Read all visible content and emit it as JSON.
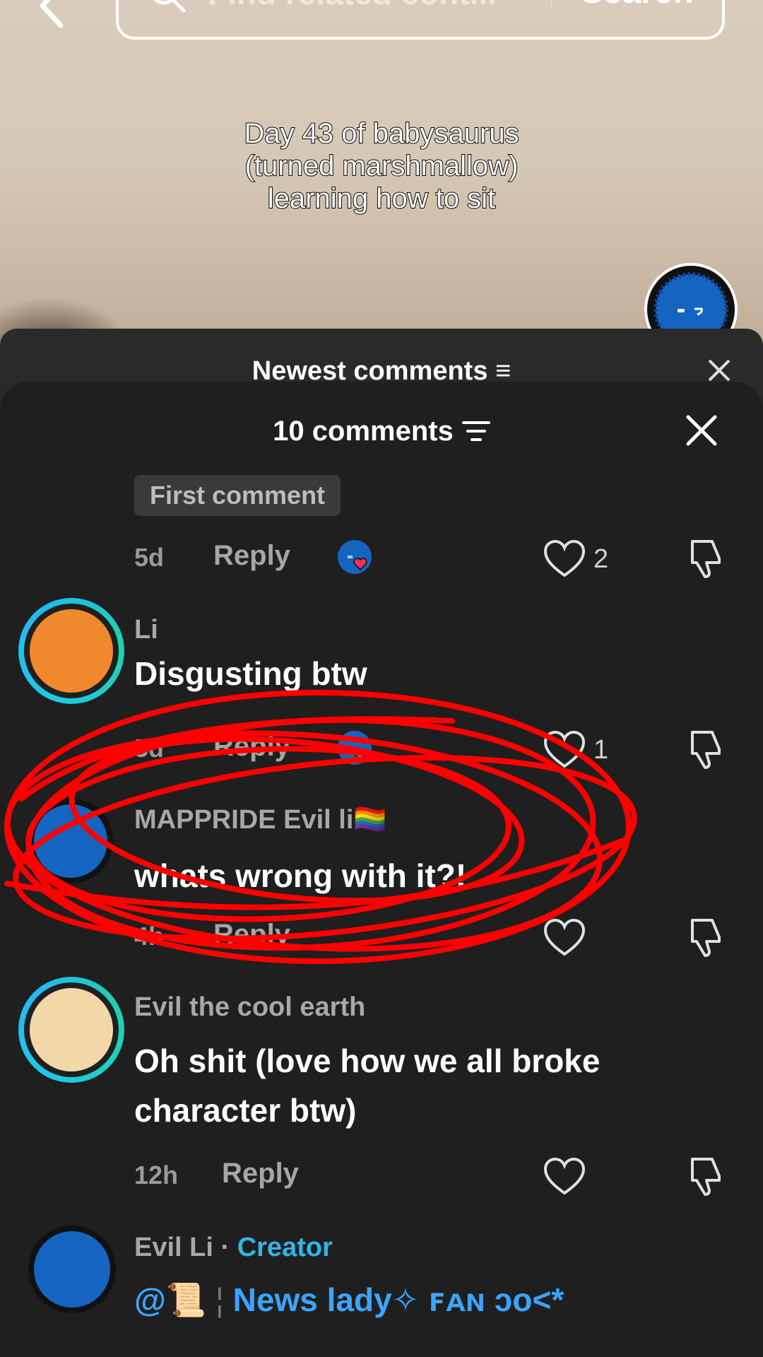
{
  "header": {
    "search_placeholder": "Find related cont...",
    "search_button": "Search"
  },
  "video": {
    "caption_lines": [
      "Day 43 of babysaurus",
      "(turned marshmallow)",
      "learning how to sit"
    ]
  },
  "ghost_sheet": {
    "title": "Newest comments"
  },
  "sheet": {
    "title": "10 comments",
    "first_comment_badge": "First comment",
    "first_comment_actions": {
      "time": "5d",
      "reply": "Reply",
      "likes": "2"
    }
  },
  "comments": [
    {
      "name": "Li",
      "text": "Disgusting btw",
      "time": "5d",
      "reply": "Reply",
      "likes": "1",
      "avatar_color": "#f0892e"
    },
    {
      "name": "MAPPRIDE Evil li🏳️‍🌈",
      "text": "whats wrong with it?!",
      "time": "4h",
      "reply": "Reply",
      "likes": "",
      "avatar_color": "#1565c0"
    },
    {
      "name": "Evil the cool earth",
      "text": "Oh shit (love how we all broke character btw)",
      "time": "12h",
      "reply": "Reply",
      "likes": "",
      "avatar_color": "#f2d7a8"
    },
    {
      "name": "Evil Li",
      "creator_sep": "·",
      "creator_label": "Creator",
      "text_prefix": "@📜",
      "text_mention": "News lady✧ ꜰᴀɴ ↄᴏ<*",
      "avatar_color": "#1565c0"
    }
  ],
  "colors": {
    "sheet_bg": "#1f1f1f",
    "accent_red": "#f0325a",
    "creator_blue": "#33b5e5",
    "scribble_red": "#ff0000"
  }
}
